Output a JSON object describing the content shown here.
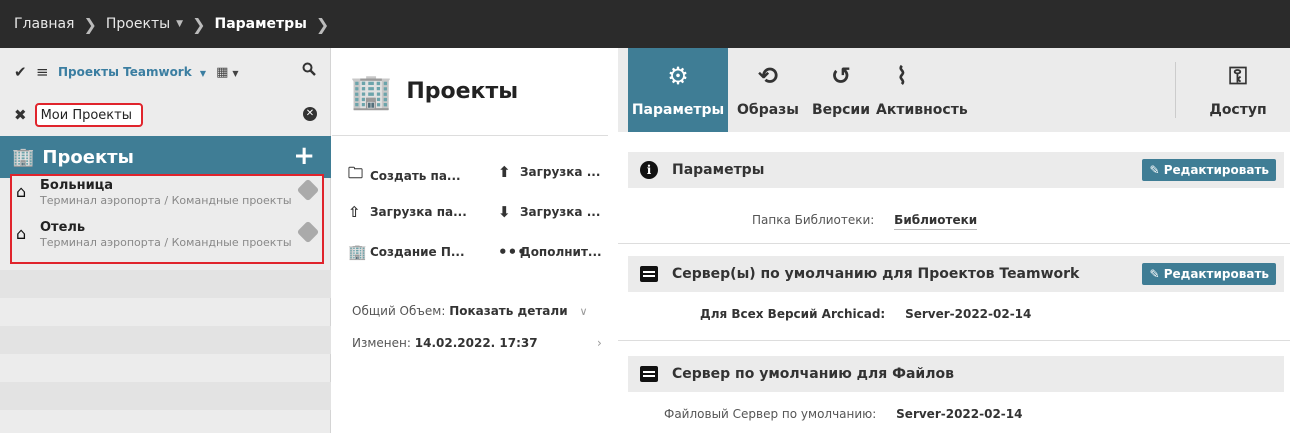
{
  "breadcrumb": {
    "home": "Главная",
    "projects": "Проекты",
    "current": "Параметры"
  },
  "left": {
    "filter_label": "Проекты Teamwork",
    "search_value": "Мои Проекты",
    "header_title": "Проекты",
    "items": [
      {
        "name": "Больница",
        "path": "Терминал аэропорта / Командные проекты"
      },
      {
        "name": "Отель",
        "path": "Терминал аэропорта / Командные проекты"
      }
    ]
  },
  "middle": {
    "title": "Проекты",
    "actions": [
      "Создать па...",
      "Загрузка ...",
      "Загрузка па...",
      "Загрузка ...",
      "Создание П...",
      "Дополнит..."
    ],
    "total_label": "Общий Объем:",
    "total_value": "Показать детали",
    "modified_label": "Изменен:",
    "modified_value": "14.02.2022. 17:37"
  },
  "tabs": {
    "params": "Параметры",
    "images": "Образы",
    "versions": "Версии",
    "activity": "Активность",
    "access": "Доступ"
  },
  "sections": {
    "params": {
      "title": "Параметры",
      "edit": "Редактировать",
      "key": "Папка Библиотеки:",
      "value": "Библиотеки"
    },
    "servers": {
      "title": "Сервер(ы) по умолчанию для Проектов Teamwork",
      "edit": "Редактировать",
      "key": "Для Всех Версий Archicad:",
      "value": "Server-2022-02-14"
    },
    "files": {
      "title": "Сервер по умолчанию для Файлов",
      "key": "Файловый Сервер по умолчанию:",
      "value": "Server-2022-02-14"
    }
  },
  "colors": {
    "accent": "#3f7d95",
    "highlight": "#e0242c",
    "topbar": "#2b2b2b"
  }
}
